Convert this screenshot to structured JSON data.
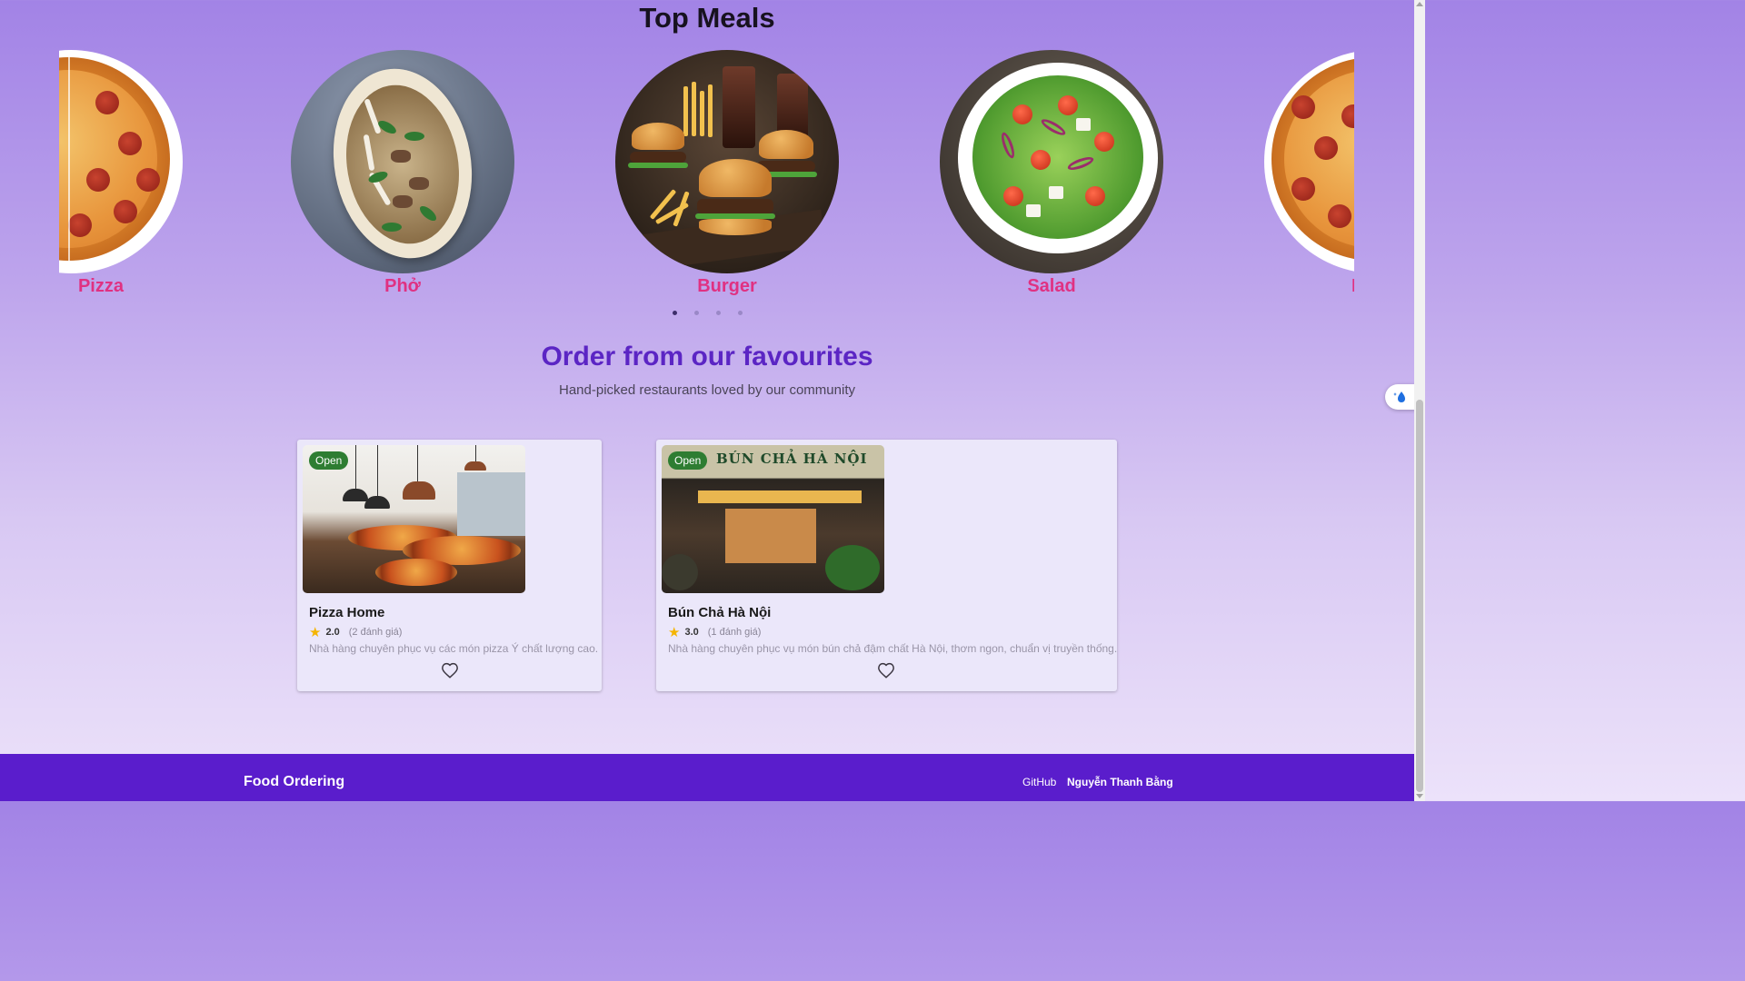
{
  "top_meals": {
    "title": "Top Meals",
    "items": [
      {
        "label": "Pizza"
      },
      {
        "label": "Phở"
      },
      {
        "label": "Burger"
      },
      {
        "label": "Salad"
      },
      {
        "label": "Pizza"
      }
    ],
    "pagination": {
      "count": 4,
      "active": 1
    }
  },
  "favourites": {
    "title": "Order from our favourites",
    "subtitle": "Hand-picked restaurants loved by our community",
    "restaurants": [
      {
        "status": "Open",
        "name": "Pizza Home",
        "rating": "2.0",
        "reviews": "(2 đánh giá)",
        "description": "Nhà hàng chuyên phục vụ các món pizza Ý chất lượng cao."
      },
      {
        "status": "Open",
        "name": "Bún Chả Hà Nội",
        "rating": "3.0",
        "reviews": "(1 đánh giá)",
        "description": "Nhà hàng chuyên phục vụ món bún chả đậm chất Hà Nội, thơm ngon, chuẩn vị truyền thống.",
        "sign": "BÚN CHẢ HÀ NỘI"
      }
    ]
  },
  "footer": {
    "brand": "Food Ordering",
    "github": "GitHub",
    "author": "Nguyễn Thanh Bằng"
  },
  "colors": {
    "accent": "#5a1dcc",
    "heading": "#5b25c4",
    "dish_label": "#e03182",
    "open_badge": "#2e7d32",
    "star": "#f5b400"
  },
  "icons": [
    "star-icon",
    "heart-icon",
    "drop-sparkle-icon"
  ]
}
